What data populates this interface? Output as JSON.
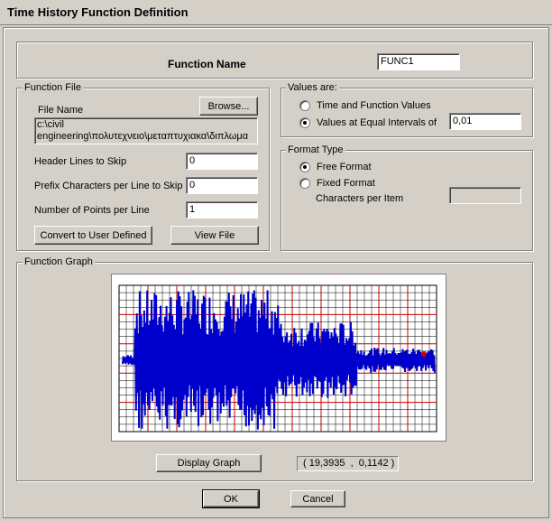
{
  "window": {
    "title": "Time History  Function Definition"
  },
  "function_name": {
    "label": "Function Name",
    "value": "FUNC1"
  },
  "function_file": {
    "legend": "Function File",
    "file_name_label": "File Name",
    "browse_label": "Browse...",
    "path_line1": "c:\\civil",
    "path_line2": "engineering\\πολυτεχνειο\\μεταπτυχιακα\\διπλωμα",
    "header_lines_label": "Header Lines to Skip",
    "header_lines_value": "0",
    "prefix_chars_label": "Prefix Characters per Line to Skip",
    "prefix_chars_value": "0",
    "points_per_line_label": "Number of Points per Line",
    "points_per_line_value": "1",
    "convert_label": "Convert to User Defined",
    "view_file_label": "View File"
  },
  "values_are": {
    "legend": "Values are:",
    "option1_label": "Time and Function Values",
    "option2_label": "Values at Equal Intervals of",
    "interval_value": "0,01",
    "selected": "option2"
  },
  "format_type": {
    "legend": "Format Type",
    "free_label": "Free Format",
    "fixed_label": "Fixed Format",
    "chars_per_item_label": "Characters per Item",
    "chars_per_item_value": "",
    "selected": "free"
  },
  "function_graph": {
    "legend": "Function Graph",
    "display_graph_label": "Display Graph",
    "coord_readout": "( 19,3935  ,  0,1142 )",
    "colors": {
      "background": "#ffffff",
      "minor_grid": "#000000",
      "major_grid": "#cc0000",
      "signal": "#0000cc",
      "marker": "#cc0000"
    }
  },
  "footer": {
    "ok_label": "OK",
    "cancel_label": "Cancel"
  }
}
